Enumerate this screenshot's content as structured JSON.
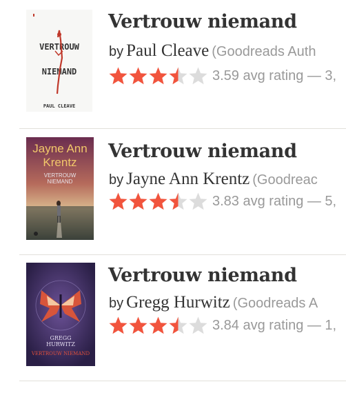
{
  "results": [
    {
      "title": "Vertrouw niemand",
      "by": "by",
      "author": "Paul Cleave",
      "author_note": "(Goodreads Auth",
      "rating_text": "3.59 avg rating — 3,",
      "stars": 3.59,
      "cover": {
        "line1": "VERTROUW",
        "line2": "NIEMAND",
        "author": "PAUL CLEAVE"
      }
    },
    {
      "title": "Vertrouw niemand",
      "by": "by",
      "author": "Jayne Ann Krentz",
      "author_note": "(Goodreac",
      "rating_text": "3.83 avg rating — 5,",
      "stars": 3.83,
      "cover": {
        "author_line1": "Jayne Ann",
        "author_line2": "Krentz",
        "title_line1": "VERTROUW",
        "title_line2": "NIEMAND"
      }
    },
    {
      "title": "Vertrouw niemand",
      "by": "by",
      "author": "Gregg Hurwitz",
      "author_note": "(Goodreads A",
      "rating_text": "3.84 avg rating — 1,",
      "stars": 3.84,
      "cover": {
        "author_line1": "GREGG",
        "author_line2": "HURWITZ",
        "title": "VERTROUW NIEMAND"
      }
    }
  ],
  "colors": {
    "star_filled": "#f1543d",
    "star_empty": "#dcdcdc",
    "text_dark": "#333333",
    "text_muted": "#999999"
  }
}
